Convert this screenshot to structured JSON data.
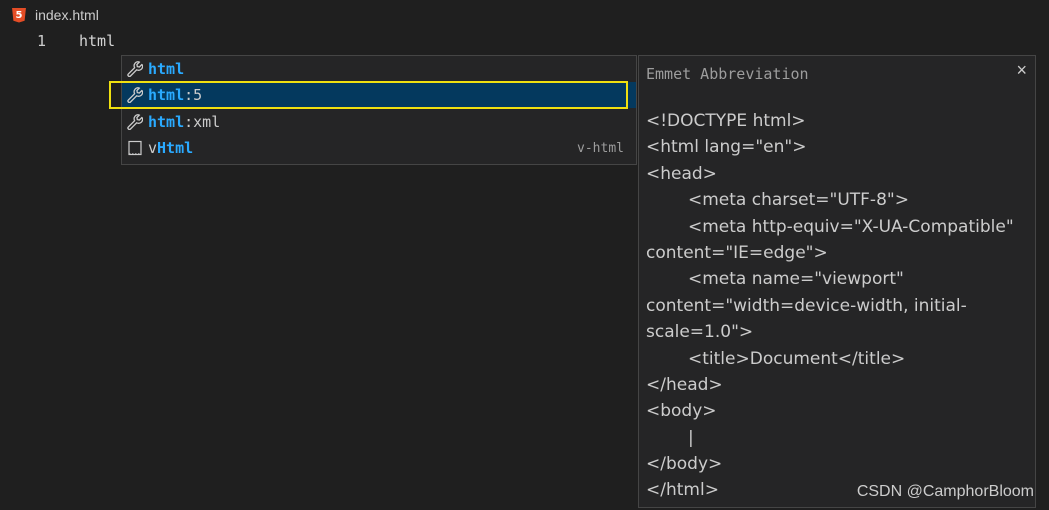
{
  "tab": {
    "filename": "index.html",
    "icon": "html5-icon"
  },
  "editor": {
    "line_number": "1",
    "line_text": "html"
  },
  "suggestions": [
    {
      "prefix": "",
      "match": "html",
      "suffix": "",
      "icon": "wrench-icon",
      "detail": ""
    },
    {
      "prefix": "",
      "match": "html",
      "suffix": ":5",
      "icon": "wrench-icon",
      "detail": ""
    },
    {
      "prefix": "",
      "match": "html",
      "suffix": ":xml",
      "icon": "wrench-icon",
      "detail": ""
    },
    {
      "prefix": "v",
      "match": "Html",
      "suffix": "",
      "icon": "snippet-icon",
      "detail": "v-html"
    }
  ],
  "details": {
    "title": "Emmet Abbreviation",
    "close": "×",
    "lines": [
      "<!DOCTYPE html>",
      "<html lang=\"en\">",
      "<head>",
      "<meta charset=\"UTF-8\">",
      "<meta http-equiv=\"X-UA-Compatible\"",
      "content=\"IE=edge\">",
      "<meta name=\"viewport\"",
      "content=\"width=device-width, initial-",
      "scale=1.0\">",
      "<title>Document</title>",
      "</head>",
      "<body>",
      "|",
      "</body>",
      "</html>"
    ]
  },
  "watermark": "CSDN @CamphorBloom",
  "colors": {
    "background": "#1f1f1f",
    "selected_row": "#04395e",
    "match_highlight": "#2aaaff",
    "annotation_box": "#f0e010"
  }
}
